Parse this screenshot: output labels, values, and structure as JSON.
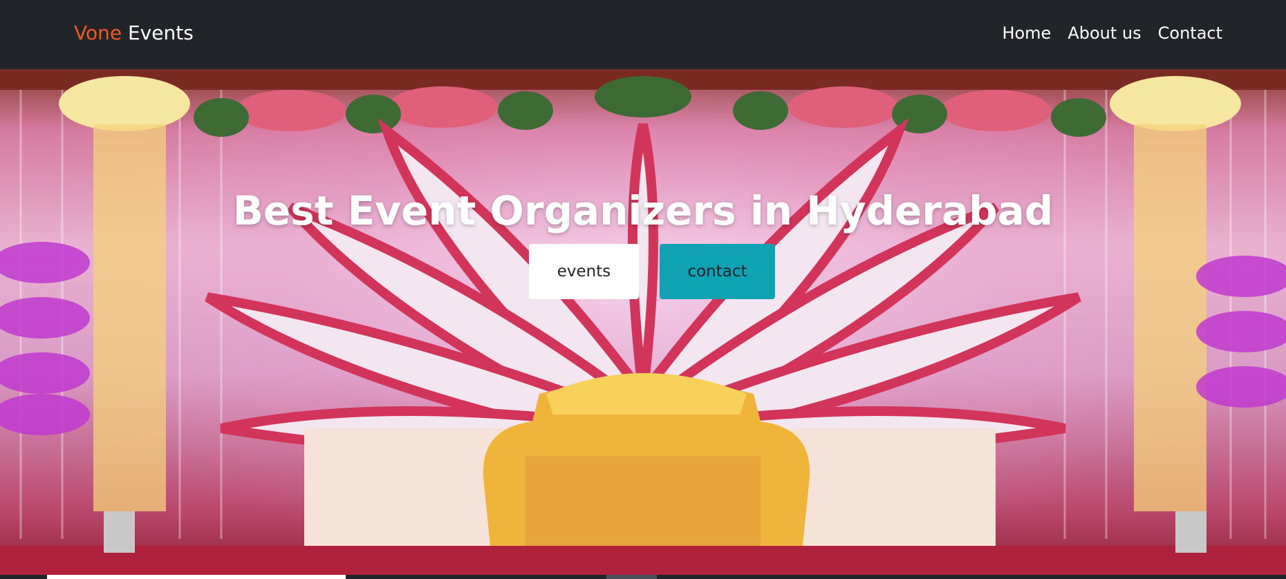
{
  "navbar": {
    "brand_accent": "Vone",
    "brand_rest": " Events",
    "links": [
      "Home",
      "About us",
      "Contact"
    ]
  },
  "hero": {
    "title": "Best Event Organizers in Hyderabad",
    "buttons": {
      "events": "events",
      "contact": "contact"
    },
    "image": "wedding-stage-flower-decoration"
  },
  "colors": {
    "navbar_bg": "#212529",
    "brand_accent": "#f05a1a",
    "contact_button": "#0ea2b2"
  }
}
